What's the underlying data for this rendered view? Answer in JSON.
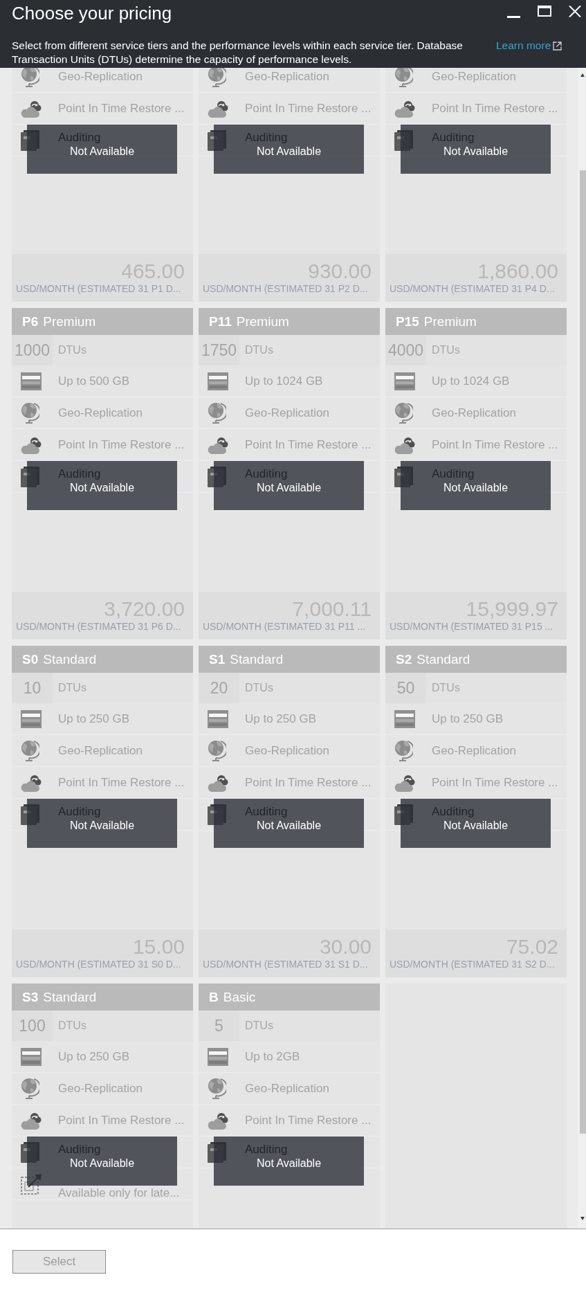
{
  "window": {
    "title": "Choose your pricing"
  },
  "intro": {
    "text": "Select from different service tiers and the performance levels within each service tier. Database Transaction Units (DTUs) determine the capacity of performance levels.",
    "link": "Learn more"
  },
  "cards": [
    {
      "selected": false,
      "features": [
        {
          "kind": "geo",
          "text": "Geo-Replication"
        },
        {
          "kind": "restore",
          "text": "Point In Time Restore ..."
        },
        {
          "kind": "audit",
          "text": "Auditing"
        }
      ],
      "overlay": "Not Available",
      "price": {
        "amount": "465.00",
        "note": "USD/MONTH (ESTIMATED 31 P1 D..."
      }
    },
    {
      "selected": false,
      "features": [
        {
          "kind": "geo",
          "text": "Geo-Replication"
        },
        {
          "kind": "restore",
          "text": "Point In Time Restore ..."
        },
        {
          "kind": "audit",
          "text": "Auditing"
        }
      ],
      "overlay": "Not Available",
      "price": {
        "amount": "930.00",
        "note": "USD/MONTH (ESTIMATED 31 P2 D..."
      }
    },
    {
      "selected": false,
      "features": [
        {
          "kind": "geo",
          "text": "Geo-Replication"
        },
        {
          "kind": "restore",
          "text": "Point In Time Restore ..."
        },
        {
          "kind": "audit",
          "text": "Auditing"
        }
      ],
      "overlay": "Not Available",
      "price": {
        "amount": "1,860.00",
        "note": "USD/MONTH (ESTIMATED 31 P4 D..."
      }
    },
    {
      "selected": false,
      "tier": {
        "code": "P6",
        "name": "Premium"
      },
      "dtus": {
        "count": "1000",
        "unit": "DTUs"
      },
      "features": [
        {
          "kind": "storage",
          "text": "Up to 500 GB"
        },
        {
          "kind": "geo",
          "text": "Geo-Replication"
        },
        {
          "kind": "restore",
          "text": "Point In Time Restore ..."
        },
        {
          "kind": "audit",
          "text": "Auditing"
        }
      ],
      "overlay": "Not Available",
      "price": {
        "amount": "3,720.00",
        "note": "USD/MONTH (ESTIMATED 31 P6 D..."
      }
    },
    {
      "selected": false,
      "tier": {
        "code": "P11",
        "name": "Premium"
      },
      "dtus": {
        "count": "1750",
        "unit": "DTUs"
      },
      "features": [
        {
          "kind": "storage",
          "text": "Up to 1024 GB"
        },
        {
          "kind": "geo",
          "text": "Geo-Replication"
        },
        {
          "kind": "restore",
          "text": "Point In Time Restore ..."
        },
        {
          "kind": "audit",
          "text": "Auditing"
        }
      ],
      "overlay": "Not Available",
      "price": {
        "amount": "7,000.11",
        "note": "USD/MONTH (ESTIMATED 31 P11 ..."
      }
    },
    {
      "selected": false,
      "tier": {
        "code": "P15",
        "name": "Premium"
      },
      "dtus": {
        "count": "4000",
        "unit": "DTUs"
      },
      "features": [
        {
          "kind": "storage",
          "text": "Up to 1024 GB"
        },
        {
          "kind": "geo",
          "text": "Geo-Replication"
        },
        {
          "kind": "restore",
          "text": "Point In Time Restore ..."
        },
        {
          "kind": "audit",
          "text": "Auditing"
        }
      ],
      "overlay": "Not Available",
      "price": {
        "amount": "15,999.97",
        "note": "USD/MONTH (ESTIMATED 31 P15 ..."
      }
    },
    {
      "selected": false,
      "tier": {
        "code": "S0",
        "name": "Standard"
      },
      "dtus": {
        "count": "10",
        "unit": "DTUs"
      },
      "features": [
        {
          "kind": "storage",
          "text": "Up to 250 GB"
        },
        {
          "kind": "geo",
          "text": "Geo-Replication"
        },
        {
          "kind": "restore",
          "text": "Point In Time Restore ..."
        },
        {
          "kind": "audit",
          "text": "Auditing"
        }
      ],
      "overlay": "Not Available",
      "price": {
        "amount": "15.00",
        "note": "USD/MONTH (ESTIMATED 31 S0 D..."
      }
    },
    {
      "selected": false,
      "tier": {
        "code": "S1",
        "name": "Standard"
      },
      "dtus": {
        "count": "20",
        "unit": "DTUs"
      },
      "features": [
        {
          "kind": "storage",
          "text": "Up to 250 GB"
        },
        {
          "kind": "geo",
          "text": "Geo-Replication"
        },
        {
          "kind": "restore",
          "text": "Point In Time Restore ..."
        },
        {
          "kind": "audit",
          "text": "Auditing"
        }
      ],
      "overlay": "Not Available",
      "price": {
        "amount": "30.00",
        "note": "USD/MONTH (ESTIMATED 31 S1 D..."
      }
    },
    {
      "selected": false,
      "tier": {
        "code": "S2",
        "name": "Standard"
      },
      "dtus": {
        "count": "50",
        "unit": "DTUs"
      },
      "features": [
        {
          "kind": "storage",
          "text": "Up to 250 GB"
        },
        {
          "kind": "geo",
          "text": "Geo-Replication"
        },
        {
          "kind": "restore",
          "text": "Point In Time Restore ..."
        },
        {
          "kind": "audit",
          "text": "Auditing"
        }
      ],
      "overlay": "Not Available",
      "price": {
        "amount": "75.02",
        "note": "USD/MONTH (ESTIMATED 31 S2 D..."
      }
    },
    {
      "selected": false,
      "tier": {
        "code": "S3",
        "name": "Standard"
      },
      "dtus": {
        "count": "100",
        "unit": "DTUs"
      },
      "features": [
        {
          "kind": "storage",
          "text": "Up to 250 GB"
        },
        {
          "kind": "geo",
          "text": "Geo-Replication"
        },
        {
          "kind": "restore",
          "text": "Point In Time Restore ..."
        },
        {
          "kind": "audit",
          "text": "Auditing"
        },
        {
          "kind": "scale",
          "text": "Available only for late..."
        }
      ],
      "overlay": "Not Available"
    },
    {
      "selected": false,
      "tier": {
        "code": "B",
        "name": "Basic"
      },
      "dtus": {
        "count": "5",
        "unit": "DTUs"
      },
      "features": [
        {
          "kind": "storage",
          "text": "Up to 2GB"
        },
        {
          "kind": "geo",
          "text": "Geo-Replication"
        },
        {
          "kind": "restore",
          "text": "Point In Time Restore ..."
        },
        {
          "kind": "audit",
          "text": "Auditing"
        }
      ],
      "overlay": "Not Available"
    }
  ],
  "footer": {
    "select_button": {
      "label": "Select",
      "disabled": true
    }
  }
}
